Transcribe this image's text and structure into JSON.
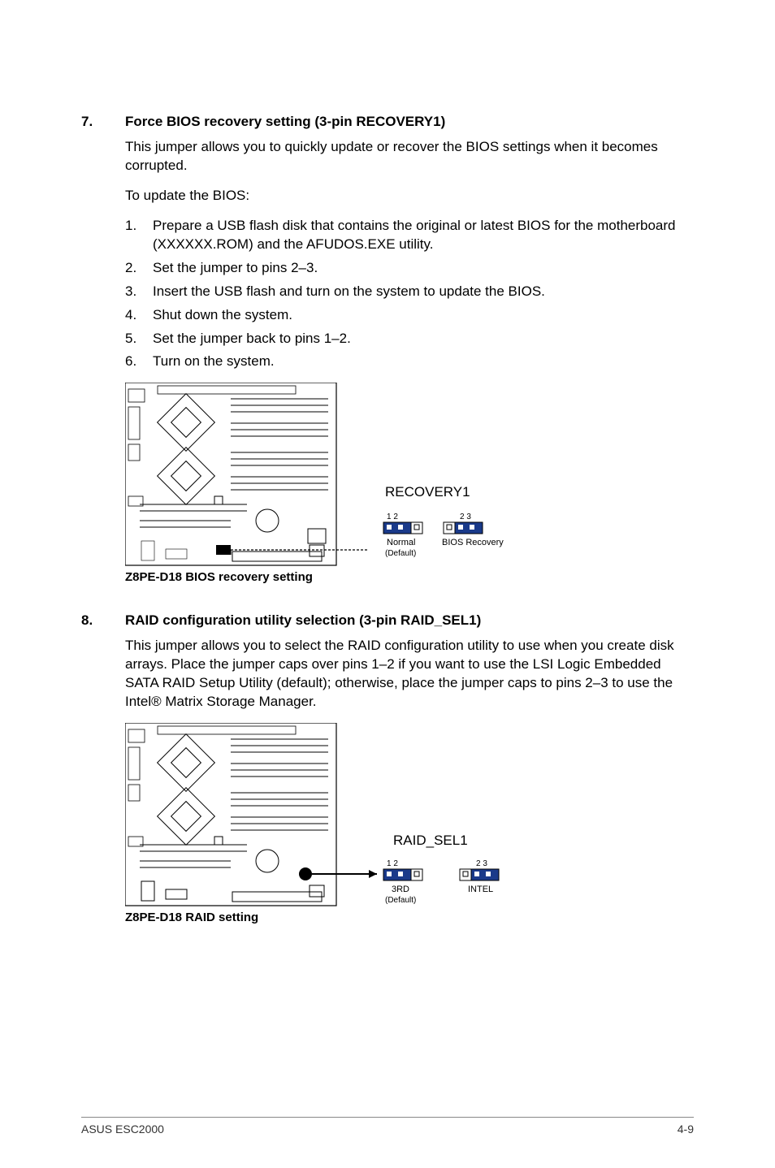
{
  "sections": [
    {
      "num": "7.",
      "title": "Force BIOS recovery setting (3-pin RECOVERY1)",
      "intro": "This jumper allows you to quickly update or recover the BIOS settings when it becomes corrupted.",
      "lead": "To update the BIOS:",
      "steps": [
        {
          "n": "1.",
          "t": "Prepare a USB flash disk that contains the original or latest BIOS for the motherboard (XXXXXX.ROM) and the AFUDOS.EXE utility."
        },
        {
          "n": "2.",
          "t": "Set the jumper to pins 2–3."
        },
        {
          "n": "3.",
          "t": "Insert the USB flash and turn on the system to update the BIOS."
        },
        {
          "n": "4.",
          "t": "Shut down the system."
        },
        {
          "n": "5.",
          "t": "Set the jumper back to pins 1–2."
        },
        {
          "n": "6.",
          "t": "Turn on the system."
        }
      ],
      "diagram": {
        "caption": "Z8PE-D18 BIOS recovery setting",
        "header": "RECOVERY1",
        "leftTop": "1  2",
        "leftLabel1": "Normal",
        "leftLabel2": "(Default)",
        "rightTop": "2  3",
        "rightLabel": "BIOS Recovery"
      }
    },
    {
      "num": "8.",
      "title": "RAID configuration utility selection (3-pin RAID_SEL1)",
      "intro": "This jumper allows you to select the RAID configuration utility to use when you create disk arrays. Place the jumper caps over pins 1–2 if you want to use the LSI Logic Embedded SATA RAID Setup Utility (default); otherwise, place the jumper caps to pins 2–3 to use the Intel® Matrix Storage Manager.",
      "diagram": {
        "caption": "Z8PE-D18 RAID setting",
        "header": "RAID_SEL1",
        "leftTop": "1  2",
        "leftLabel1": "3RD",
        "leftLabel2": "(Default)",
        "rightTop": "2  3",
        "rightLabel": "INTEL"
      }
    }
  ],
  "footer": {
    "left": "ASUS ESC2000",
    "right": "4-9"
  }
}
